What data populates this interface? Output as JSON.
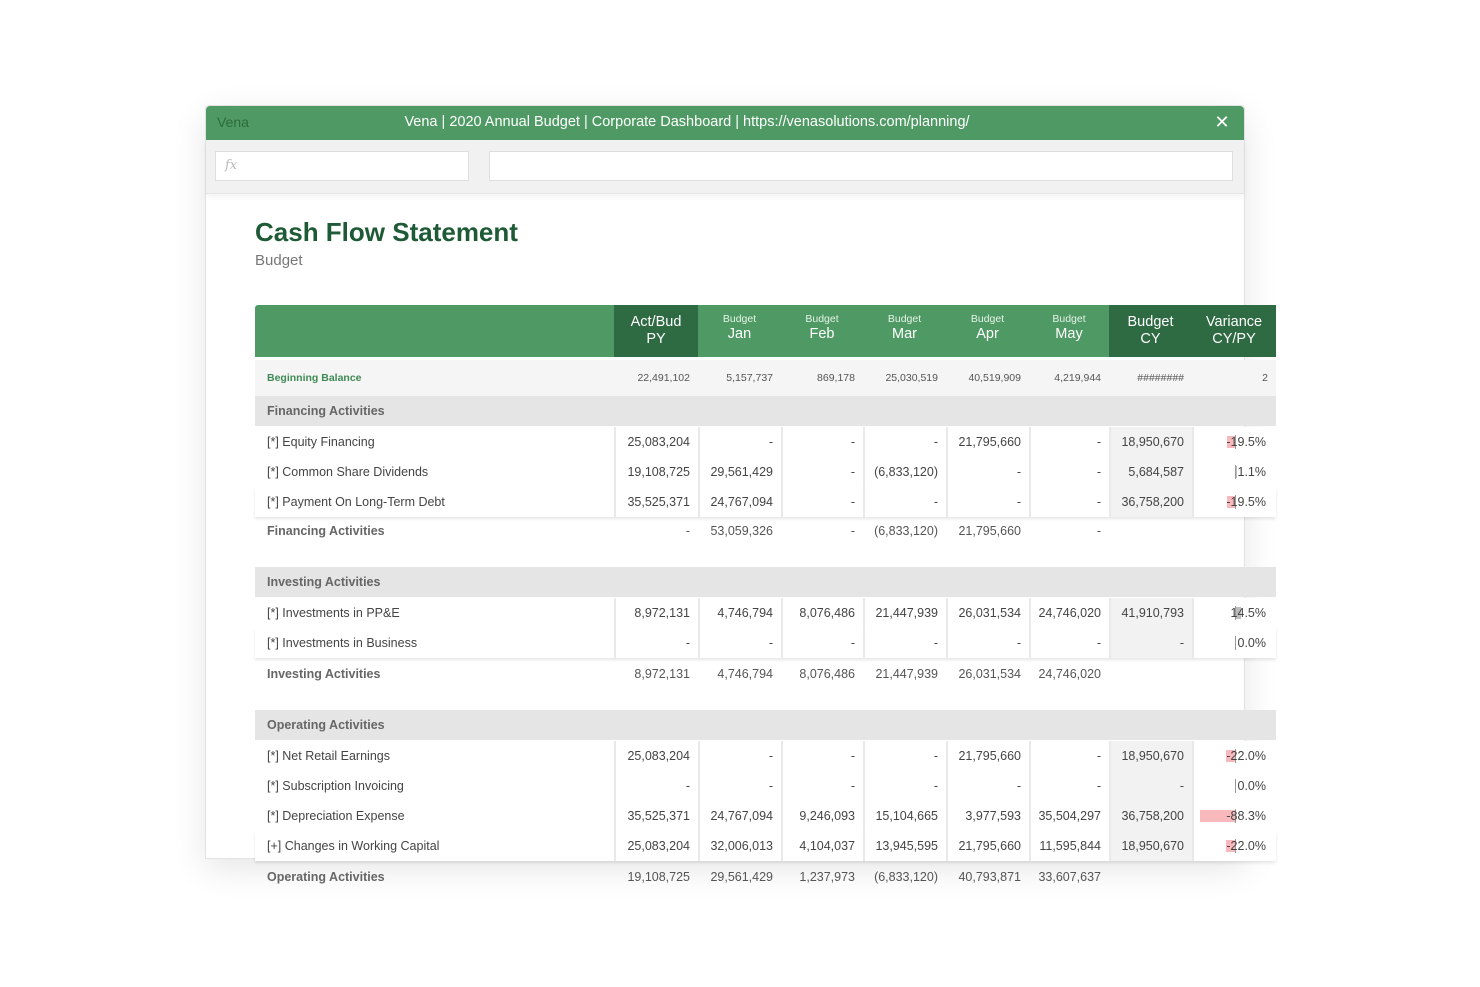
{
  "window": {
    "logo": "Vena",
    "title": "Vena | 2020 Annual Budget | Corporate Dashboard | https://venasolutions.com/planning/",
    "close_icon": "close-icon"
  },
  "toolbar": {
    "fx_placeholder": "fx",
    "formula_value": ""
  },
  "sheet": {
    "title": "Cash Flow Statement",
    "subtitle": "Budget"
  },
  "columns": [
    {
      "small": "",
      "line1": "Act/Bud",
      "line2": "PY"
    },
    {
      "small": "Budget",
      "line1": "Jan",
      "line2": ""
    },
    {
      "small": "Budget",
      "line1": "Feb",
      "line2": ""
    },
    {
      "small": "Budget",
      "line1": "Mar",
      "line2": ""
    },
    {
      "small": "Budget",
      "line1": "Apr",
      "line2": ""
    },
    {
      "small": "Budget",
      "line1": "May",
      "line2": ""
    },
    {
      "small": "",
      "line1": "Budget",
      "line2": "CY"
    },
    {
      "small": "",
      "line1": "Variance",
      "line2": "CY/PY"
    }
  ],
  "beginning_balance": {
    "label": "Beginning Balance",
    "values": [
      "22,491,102",
      "5,157,737",
      "869,178",
      "25,030,519",
      "40,519,909",
      "4,219,944",
      "########",
      "2"
    ]
  },
  "sections": [
    {
      "name": "Financing Activities",
      "rows": [
        {
          "label": "[*] Equity Financing",
          "values": [
            "25,083,204",
            "-",
            "-",
            "-",
            "21,795,660",
            "-",
            "18,950,670"
          ],
          "variance": "-19.5%",
          "variance_value": -19.5
        },
        {
          "label": "[*] Common Share Dividends",
          "values": [
            "19,108,725",
            "29,561,429",
            "-",
            "(6,833,120)",
            "-",
            "-",
            "5,684,587"
          ],
          "variance": "1.1%",
          "variance_value": 1.1
        },
        {
          "label": "[*] Payment On Long-Term Debt",
          "values": [
            "35,525,371",
            "24,767,094",
            "-",
            "-",
            "-",
            "-",
            "36,758,200"
          ],
          "variance": "-19.5%",
          "variance_value": -19.5
        }
      ],
      "total": {
        "label": "Financing Activities",
        "values": [
          "-",
          "53,059,326",
          "-",
          "(6,833,120)",
          "21,795,660",
          "-"
        ]
      }
    },
    {
      "name": "Investing Activities",
      "rows": [
        {
          "label": "[*] Investments in PP&E",
          "values": [
            "8,972,131",
            "4,746,794",
            "8,076,486",
            "21,447,939",
            "26,031,534",
            "24,746,020",
            "41,910,793"
          ],
          "variance": "14.5%",
          "variance_value": 14.5
        },
        {
          "label": "[*] Investments in Business",
          "values": [
            "-",
            "-",
            "-",
            "-",
            "-",
            "-",
            "-"
          ],
          "variance": "0.0%",
          "variance_value": 0.0
        }
      ],
      "total": {
        "label": "Investing Activities",
        "values": [
          "8,972,131",
          "4,746,794",
          "8,076,486",
          "21,447,939",
          "26,031,534",
          "24,746,020"
        ]
      }
    },
    {
      "name": "Operating Activities",
      "rows": [
        {
          "label": "[*] Net Retail Earnings",
          "values": [
            "25,083,204",
            "-",
            "-",
            "-",
            "21,795,660",
            "-",
            "18,950,670"
          ],
          "variance": "-22.0%",
          "variance_value": -22.0
        },
        {
          "label": "[*] Subscription Invoicing",
          "values": [
            "-",
            "-",
            "-",
            "-",
            "-",
            "-",
            "-"
          ],
          "variance": "0.0%",
          "variance_value": 0.0
        },
        {
          "label": "[*] Depreciation Expense",
          "values": [
            "35,525,371",
            "24,767,094",
            "9,246,093",
            "15,104,665",
            "3,977,593",
            "35,504,297",
            "36,758,200"
          ],
          "variance": "-88.3%",
          "variance_value": -88.3
        },
        {
          "label": "[+] Changes in Working Capital",
          "values": [
            "25,083,204",
            "32,006,013",
            "4,104,037",
            "13,945,595",
            "21,795,660",
            "11,595,844",
            "18,950,670"
          ],
          "variance": "-22.0%",
          "variance_value": -22.0
        }
      ],
      "total": {
        "label": "Operating Activities",
        "values": [
          "19,108,725",
          "29,561,429",
          "1,237,973",
          "(6,833,120)",
          "40,793,871",
          "33,607,637"
        ]
      }
    }
  ]
}
